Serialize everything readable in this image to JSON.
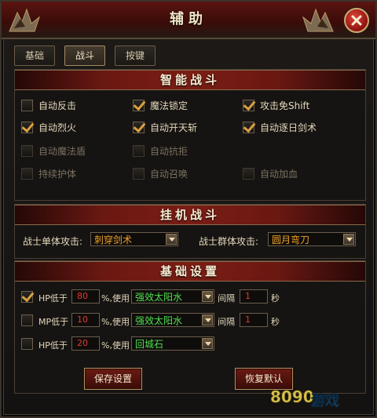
{
  "window": {
    "title": "辅助"
  },
  "tabs": [
    {
      "label": "基础",
      "active": false
    },
    {
      "label": "战斗",
      "active": true
    },
    {
      "label": "按键",
      "active": false
    }
  ],
  "smart_combat": {
    "header": "智能战斗",
    "options": [
      {
        "label": "自动反击",
        "checked": false,
        "enabled": true
      },
      {
        "label": "魔法锁定",
        "checked": true,
        "enabled": true
      },
      {
        "label": "攻击免Shift",
        "checked": true,
        "enabled": true
      },
      {
        "label": "自动烈火",
        "checked": true,
        "enabled": true
      },
      {
        "label": "自动开天斩",
        "checked": true,
        "enabled": true
      },
      {
        "label": "自动逐日剑术",
        "checked": true,
        "enabled": true
      },
      {
        "label": "自动魔法盾",
        "checked": false,
        "enabled": false
      },
      {
        "label": "自动抗拒",
        "checked": false,
        "enabled": false
      },
      {
        "label": "持续护体",
        "checked": false,
        "enabled": false
      },
      {
        "label": "自动召唤",
        "checked": false,
        "enabled": false
      },
      {
        "label": "自动加血",
        "checked": false,
        "enabled": false
      }
    ]
  },
  "auto_combat": {
    "header": "挂机战斗",
    "single_label": "战士单体攻击:",
    "single_value": "刺穿剑术",
    "group_label": "战士群体攻击:",
    "group_value": "圆月弯刀"
  },
  "basic_settings": {
    "header": "基础设置",
    "rows": [
      {
        "checked": true,
        "stat": "HP低于",
        "threshold": "80",
        "pct_use": "%,使用",
        "item": "强效太阳水",
        "interval_label": "间隔",
        "interval": "1",
        "unit": "秒"
      },
      {
        "checked": false,
        "stat": "MP低于",
        "threshold": "10",
        "pct_use": "%,使用",
        "item": "强效太阳水",
        "interval_label": "间隔",
        "interval": "1",
        "unit": "秒"
      },
      {
        "checked": false,
        "stat": "HP低于",
        "threshold": "20",
        "pct_use": "%,使用",
        "item": "回城石"
      }
    ]
  },
  "buttons": {
    "save": "保存设置",
    "restore": "恢复默认"
  },
  "watermark": {
    "brand": "8090",
    "subtitle": "游戏"
  },
  "colors": {
    "accent_red": "#7a1d15",
    "check_gold": "#d8a040",
    "item_green": "#4ee04e",
    "value_red": "#e2382e"
  }
}
